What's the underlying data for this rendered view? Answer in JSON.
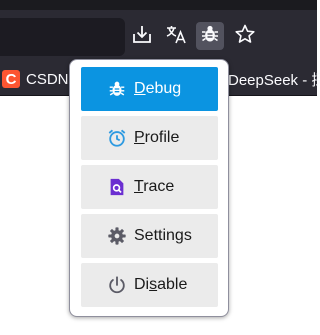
{
  "toolbar": {
    "buttons": [
      {
        "name": "download",
        "icon": "download-icon"
      },
      {
        "name": "translate",
        "icon": "translate-icon"
      },
      {
        "name": "debug-extension",
        "icon": "bug-icon",
        "active": true
      },
      {
        "name": "bookmark",
        "icon": "star-icon"
      }
    ]
  },
  "bookmarks": {
    "items": [
      {
        "label": "CSDN",
        "logo": "C"
      },
      {
        "label": "DeepSeek - 探"
      }
    ]
  },
  "menu": {
    "items": [
      {
        "id": "debug",
        "label": "Debug",
        "accesskey": "D",
        "icon": "bug-icon",
        "selected": true
      },
      {
        "id": "profile",
        "label": "Profile",
        "accesskey": "P",
        "icon": "alarm-clock-icon"
      },
      {
        "id": "trace",
        "label": "Trace",
        "accesskey": "T",
        "icon": "trace-icon"
      },
      {
        "id": "settings",
        "label": "Settings",
        "icon": "gear-icon"
      },
      {
        "id": "disable",
        "label": "Disable",
        "accesskey": "s",
        "icon": "power-icon"
      }
    ]
  },
  "colors": {
    "toolbar_bg": "#2b2a33",
    "selected_bg": "#0b94e1",
    "item_bg": "#ebebeb",
    "csdn": "#fc5531",
    "profile_icon": "#2d9ae1",
    "trace_icon": "#6b2fd1"
  }
}
